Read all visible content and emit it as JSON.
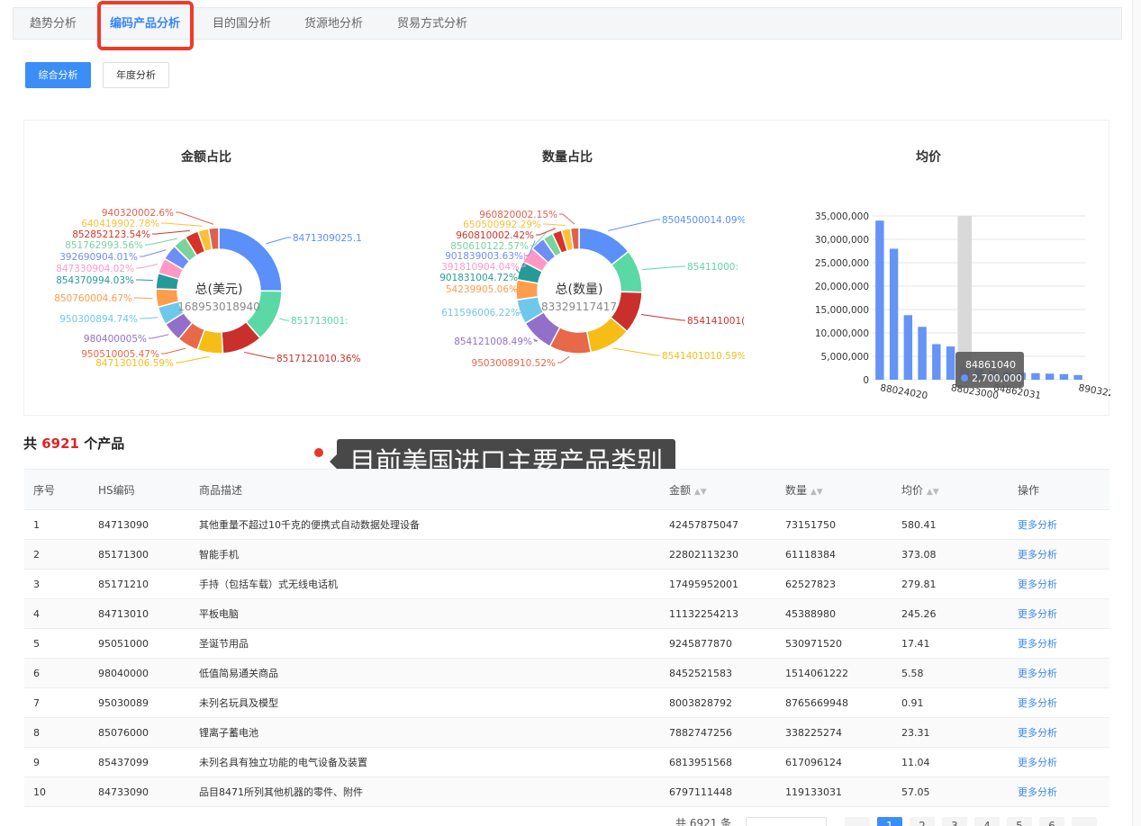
{
  "tabs": [
    "趋势分析",
    "编码产品分析",
    "目的国分析",
    "货源地分析",
    "贸易方式分析"
  ],
  "subtabs": [
    "综合分析",
    "年度分析"
  ],
  "charts": {
    "amount_title": "金额占比",
    "quantity_title": "数量占比",
    "avg_title": "均价",
    "amount_center_label": "总(美元)",
    "amount_center_value": "168953018940",
    "quantity_center_label": "总(数量)",
    "quantity_center_value": "83329117417"
  },
  "amount_labels": [
    "8471309025.1",
    "851713001:",
    "8517121010.36%",
    "847130106.59%",
    "950510005.47%",
    "980400005%",
    "950300894.74%",
    "850760004.67%",
    "854370994.03%",
    "847330904.02%",
    "392690904.01%",
    "851762993.56%",
    "852852123.54%",
    "640419902.78%",
    "940320002.6%"
  ],
  "quantity_labels": [
    "8504500014.09%",
    "85411000:",
    "854141001(",
    "8541401010.59%",
    "9503008910.52%",
    "854121008.49%",
    "611596006.22%",
    "54239905.06%",
    "901831004.72%",
    "391810904.04%",
    "901839003.63%",
    "850610122.57%",
    "960810002.42%",
    "650500992.29%",
    "960820002.15%"
  ],
  "colors": {
    "slices": [
      "#5b8ff9",
      "#5ad8a6",
      "#c9302c",
      "#f6bd16",
      "#e8684a",
      "#9270ca",
      "#6dc8ec",
      "#ff9d4d",
      "#269a99",
      "#ff99c3",
      "#6f8ef5",
      "#7ad39a",
      "#d7332a",
      "#f8c13a",
      "#e0604f"
    ],
    "bar": "#6694f5",
    "accent": "#3a87f5",
    "highlight": "#e02424"
  },
  "chart_data": {
    "type": "bar",
    "categories": [
      "88024020",
      "",
      "",
      "",
      "",
      "88023000",
      "",
      "",
      "84862031",
      "",
      "",
      "",
      "",
      "",
      "89032200"
    ],
    "values": [
      34000000,
      28000000,
      13800000,
      11300000,
      7600000,
      7100000,
      2700000,
      2300000,
      1900000,
      1700000,
      1500000,
      1400000,
      1300000,
      1200000,
      1000000
    ],
    "ylim": [
      0,
      35000000
    ],
    "yticks": [
      "35,000,000",
      "30,000,000",
      "25,000,000",
      "20,000,000",
      "15,000,000",
      "10,000,000",
      "5,000,000",
      "0"
    ],
    "tooltip": {
      "code": "84861040",
      "value": "2,700,000"
    }
  },
  "total": {
    "prefix": "共",
    "count": "6921",
    "suffix": "个产品"
  },
  "caption": "目前美国进口主要产品类别",
  "table": {
    "headers": [
      "序号",
      "HS编码",
      "商品描述",
      "金额",
      "数量",
      "均价",
      "操作"
    ],
    "rows": [
      [
        "1",
        "84713090",
        "其他重量不超过10千克的便携式自动数据处理设备",
        "42457875047",
        "73151750",
        "580.41",
        "更多分析"
      ],
      [
        "2",
        "85171300",
        "智能手机",
        "22802113230",
        "61118384",
        "373.08",
        "更多分析"
      ],
      [
        "3",
        "85171210",
        "手持（包括车载）式无线电话机",
        "17495952001",
        "62527823",
        "279.81",
        "更多分析"
      ],
      [
        "4",
        "84713010",
        "平板电脑",
        "11132254213",
        "45388980",
        "245.26",
        "更多分析"
      ],
      [
        "5",
        "95051000",
        "圣诞节用品",
        "9245877870",
        "530971520",
        "17.41",
        "更多分析"
      ],
      [
        "6",
        "98040000",
        "低值简易通关商品",
        "8452521583",
        "1514061222",
        "5.58",
        "更多分析"
      ],
      [
        "7",
        "95030089",
        "未列名玩具及模型",
        "8003828792",
        "8765669948",
        "0.91",
        "更多分析"
      ],
      [
        "8",
        "85076000",
        "锂离子蓄电池",
        "7882747256",
        "338225274",
        "23.31",
        "更多分析"
      ],
      [
        "9",
        "85437099",
        "未列名具有独立功能的电气设备及装置",
        "6813951568",
        "617096124",
        "11.04",
        "更多分析"
      ],
      [
        "10",
        "84733090",
        "品目8471所列其他机器的零件、附件",
        "6797111448",
        "119133031",
        "57.05",
        "更多分析"
      ]
    ]
  },
  "pager": {
    "total_text": "共 6921 条",
    "pages": [
      "",
      "1",
      "2",
      "3",
      "4",
      "5",
      "6",
      ""
    ]
  }
}
